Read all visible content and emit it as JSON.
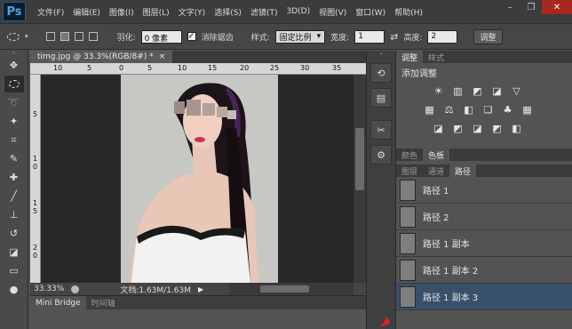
{
  "app": {
    "logo": "Ps"
  },
  "menu": [
    "文件(F)",
    "编辑(E)",
    "图像(I)",
    "图层(L)",
    "文字(Y)",
    "选择(S)",
    "滤镜(T)",
    "3D(D)",
    "视图(V)",
    "窗口(W)",
    "帮助(H)"
  ],
  "window_controls": {
    "minimize": "–",
    "restore": "❐",
    "close": "✕"
  },
  "options": {
    "feather_label": "羽化:",
    "feather_value": "0 像素",
    "antialias_checked": "✓",
    "antialias_label": "消除锯齿",
    "style_label": "样式:",
    "style_value": "固定比例",
    "width_label": "宽度:",
    "width_value": "1",
    "swap_icon": "⇄",
    "height_label": "高度:",
    "height_value": "2",
    "refine_button": "调整"
  },
  "tools": [
    "move-tool",
    "marquee-tool",
    "lasso-tool",
    "magic-wand-tool",
    "crop-tool",
    "eyedropper-tool",
    "healing-tool",
    "brush-tool",
    "stamp-tool",
    "history-brush-tool",
    "eraser-tool",
    "gradient-tool",
    "blur-tool"
  ],
  "document": {
    "tab_title": "timg.jpg @ 33.3%(RGB/8#) *",
    "tab_close": "×",
    "ruler_top": [
      "10",
      "5",
      "0",
      "5",
      "10",
      "15",
      "20",
      "25",
      "30",
      "35"
    ],
    "ruler_left": [
      "5",
      "1 0",
      "1 5",
      "2 0"
    ],
    "zoom": "33.33%",
    "doc_info": "文档:1.63M/1.63M",
    "play_icon": "▶"
  },
  "bottom_tabs": [
    "Mini Bridge",
    "时间轴"
  ],
  "panels": {
    "adjust_tabs": [
      "调整",
      "样式"
    ],
    "adjust_title": "添加调整",
    "adjust_icons_row1": [
      "☀",
      "▥",
      "◩",
      "◪",
      "▽"
    ],
    "adjust_icons_row2": [
      "▦",
      "⚖",
      "◧",
      "❏",
      "♣",
      "▦"
    ],
    "adjust_icons_row3": [
      "◪",
      "◩",
      "◪",
      "◩",
      "◧"
    ],
    "color_tabs": [
      "颜色",
      "色板"
    ],
    "layer_tabs": [
      "图层",
      "通道",
      "路径"
    ],
    "paths": [
      {
        "name": "路径 1",
        "selected": false
      },
      {
        "name": "路径 2",
        "selected": false
      },
      {
        "name": "路径 1 副本",
        "selected": false
      },
      {
        "name": "路径 1 副本 2",
        "selected": false
      },
      {
        "name": "路径 1 副本 3",
        "selected": true
      }
    ]
  }
}
